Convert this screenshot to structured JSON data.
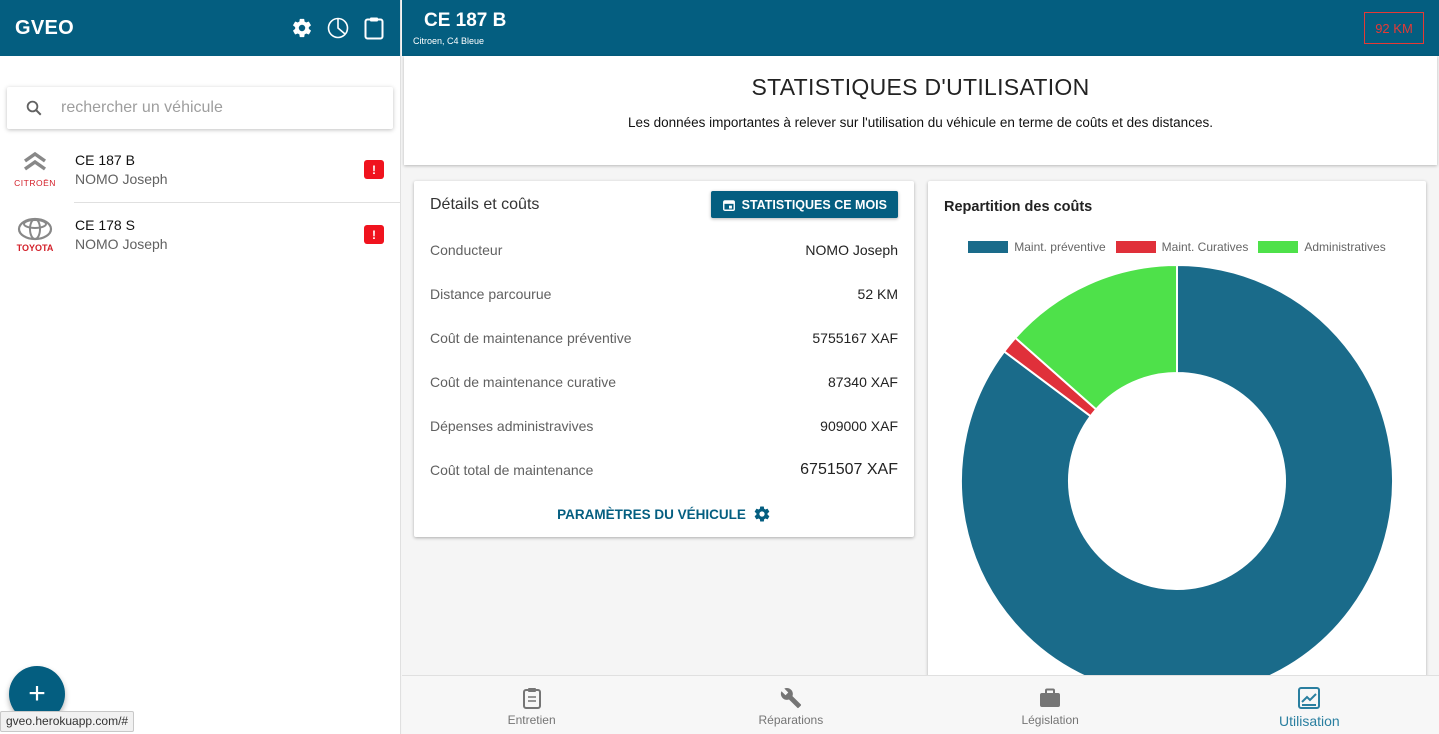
{
  "app": {
    "title": "GVEO"
  },
  "search": {
    "placeholder": "rechercher un véhicule",
    "value": ""
  },
  "vehicles": [
    {
      "plate": "CE 187 B",
      "driver": "NOMO Joseph",
      "brand": "CITROËN",
      "alert": "!"
    },
    {
      "plate": "CE 178 S",
      "driver": "NOMO Joseph",
      "brand": "TOYOTA",
      "alert": "!"
    }
  ],
  "fab": {
    "label": "+"
  },
  "status_url": "gveo.herokuapp.com/#",
  "topbar": {
    "plate": "CE 187 B",
    "subtitle": "Citroen, C4 Bleue",
    "km": "92 KM"
  },
  "intro": {
    "title": "STATISTIQUES D'UTILISATION",
    "description": "Les données importantes à relever sur l'utilisation du véhicule en terme de coûts et des distances."
  },
  "details": {
    "title": "Détails et coûts",
    "button": "STATISTIQUES CE MOIS",
    "rows": [
      {
        "label": "Conducteur",
        "value": "NOMO Joseph"
      },
      {
        "label": "Distance parcourue",
        "value": "52 KM"
      },
      {
        "label": "Coût de maintenance préventive",
        "value": "5755167 XAF"
      },
      {
        "label": "Coût de maintenance curative",
        "value": "87340 XAF"
      },
      {
        "label": "Dépenses administravives",
        "value": "909000 XAF"
      },
      {
        "label": "Coût total de maintenance",
        "value": "6751507 XAF"
      }
    ],
    "params_link": "PARAMÈTRES DU VÉHICULE"
  },
  "chart_data": {
    "type": "pie",
    "title": "Repartition des coûts",
    "categories": [
      "Maint. préventive",
      "Maint. Curatives",
      "Administratives"
    ],
    "values": [
      5755167,
      87340,
      909000
    ],
    "colors": [
      "#1a6b8a",
      "#e0303a",
      "#4ee14a"
    ],
    "donut": true,
    "legend_position": "top"
  },
  "nav": [
    {
      "label": "Entretien",
      "icon": "clipboard-icon",
      "active": false
    },
    {
      "label": "Réparations",
      "icon": "wrench-icon",
      "active": false
    },
    {
      "label": "Législation",
      "icon": "briefcase-icon",
      "active": false
    },
    {
      "label": "Utilisation",
      "icon": "chart-line-icon",
      "active": true
    }
  ],
  "colors": {
    "primary": "#045e80",
    "alert": "#f0131e",
    "active_nav": "#2a7fa0"
  }
}
